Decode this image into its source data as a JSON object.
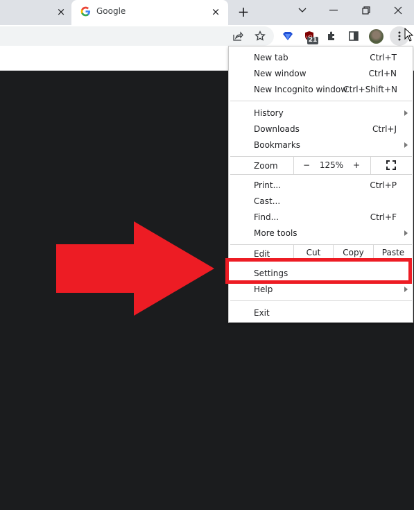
{
  "tabs": [
    {
      "title": "",
      "close_label": "×",
      "active": false
    },
    {
      "title": "Google",
      "favicon": "google-g-icon",
      "close_label": "×",
      "active": true
    }
  ],
  "tabstrip": {
    "new_tab_label": "+",
    "window_controls": [
      "tab-search-chevron-icon",
      "minimize-icon",
      "restore-icon",
      "close-window-icon"
    ]
  },
  "toolbar": {
    "icons": [
      "share-icon",
      "bookmark-star-icon",
      "extension-diamond-icon",
      "ublock-origin-icon",
      "extensions-puzzle-icon",
      "side-panel-icon",
      "profile-avatar",
      "chrome-menu-icon"
    ],
    "ublock_badge": "21"
  },
  "menu": {
    "sections": [
      [
        {
          "label": "New tab",
          "shortcut": "Ctrl+T"
        },
        {
          "label": "New window",
          "shortcut": "Ctrl+N"
        },
        {
          "label": "New Incognito window",
          "shortcut": "Ctrl+Shift+N"
        }
      ],
      [
        {
          "label": "History",
          "submenu": true
        },
        {
          "label": "Downloads",
          "shortcut": "Ctrl+J"
        },
        {
          "label": "Bookmarks",
          "submenu": true
        }
      ],
      [
        {
          "label": "Print...",
          "shortcut": "Ctrl+P"
        },
        {
          "label": "Cast..."
        },
        {
          "label": "Find...",
          "shortcut": "Ctrl+F"
        },
        {
          "label": "More tools",
          "submenu": true
        }
      ],
      [
        {
          "label": "Settings"
        },
        {
          "label": "Help",
          "submenu": true
        }
      ],
      [
        {
          "label": "Exit"
        }
      ]
    ],
    "zoom": {
      "label": "Zoom",
      "minus": "−",
      "value": "125%",
      "plus": "+",
      "fullscreen_icon": "fullscreen-icon"
    },
    "edit": {
      "label": "Edit",
      "cut": "Cut",
      "copy": "Copy",
      "paste": "Paste"
    }
  },
  "annotation": {
    "arrow_color": "#ed1c24",
    "highlight_color": "#ed1c24",
    "highlighted_item": "Settings"
  }
}
